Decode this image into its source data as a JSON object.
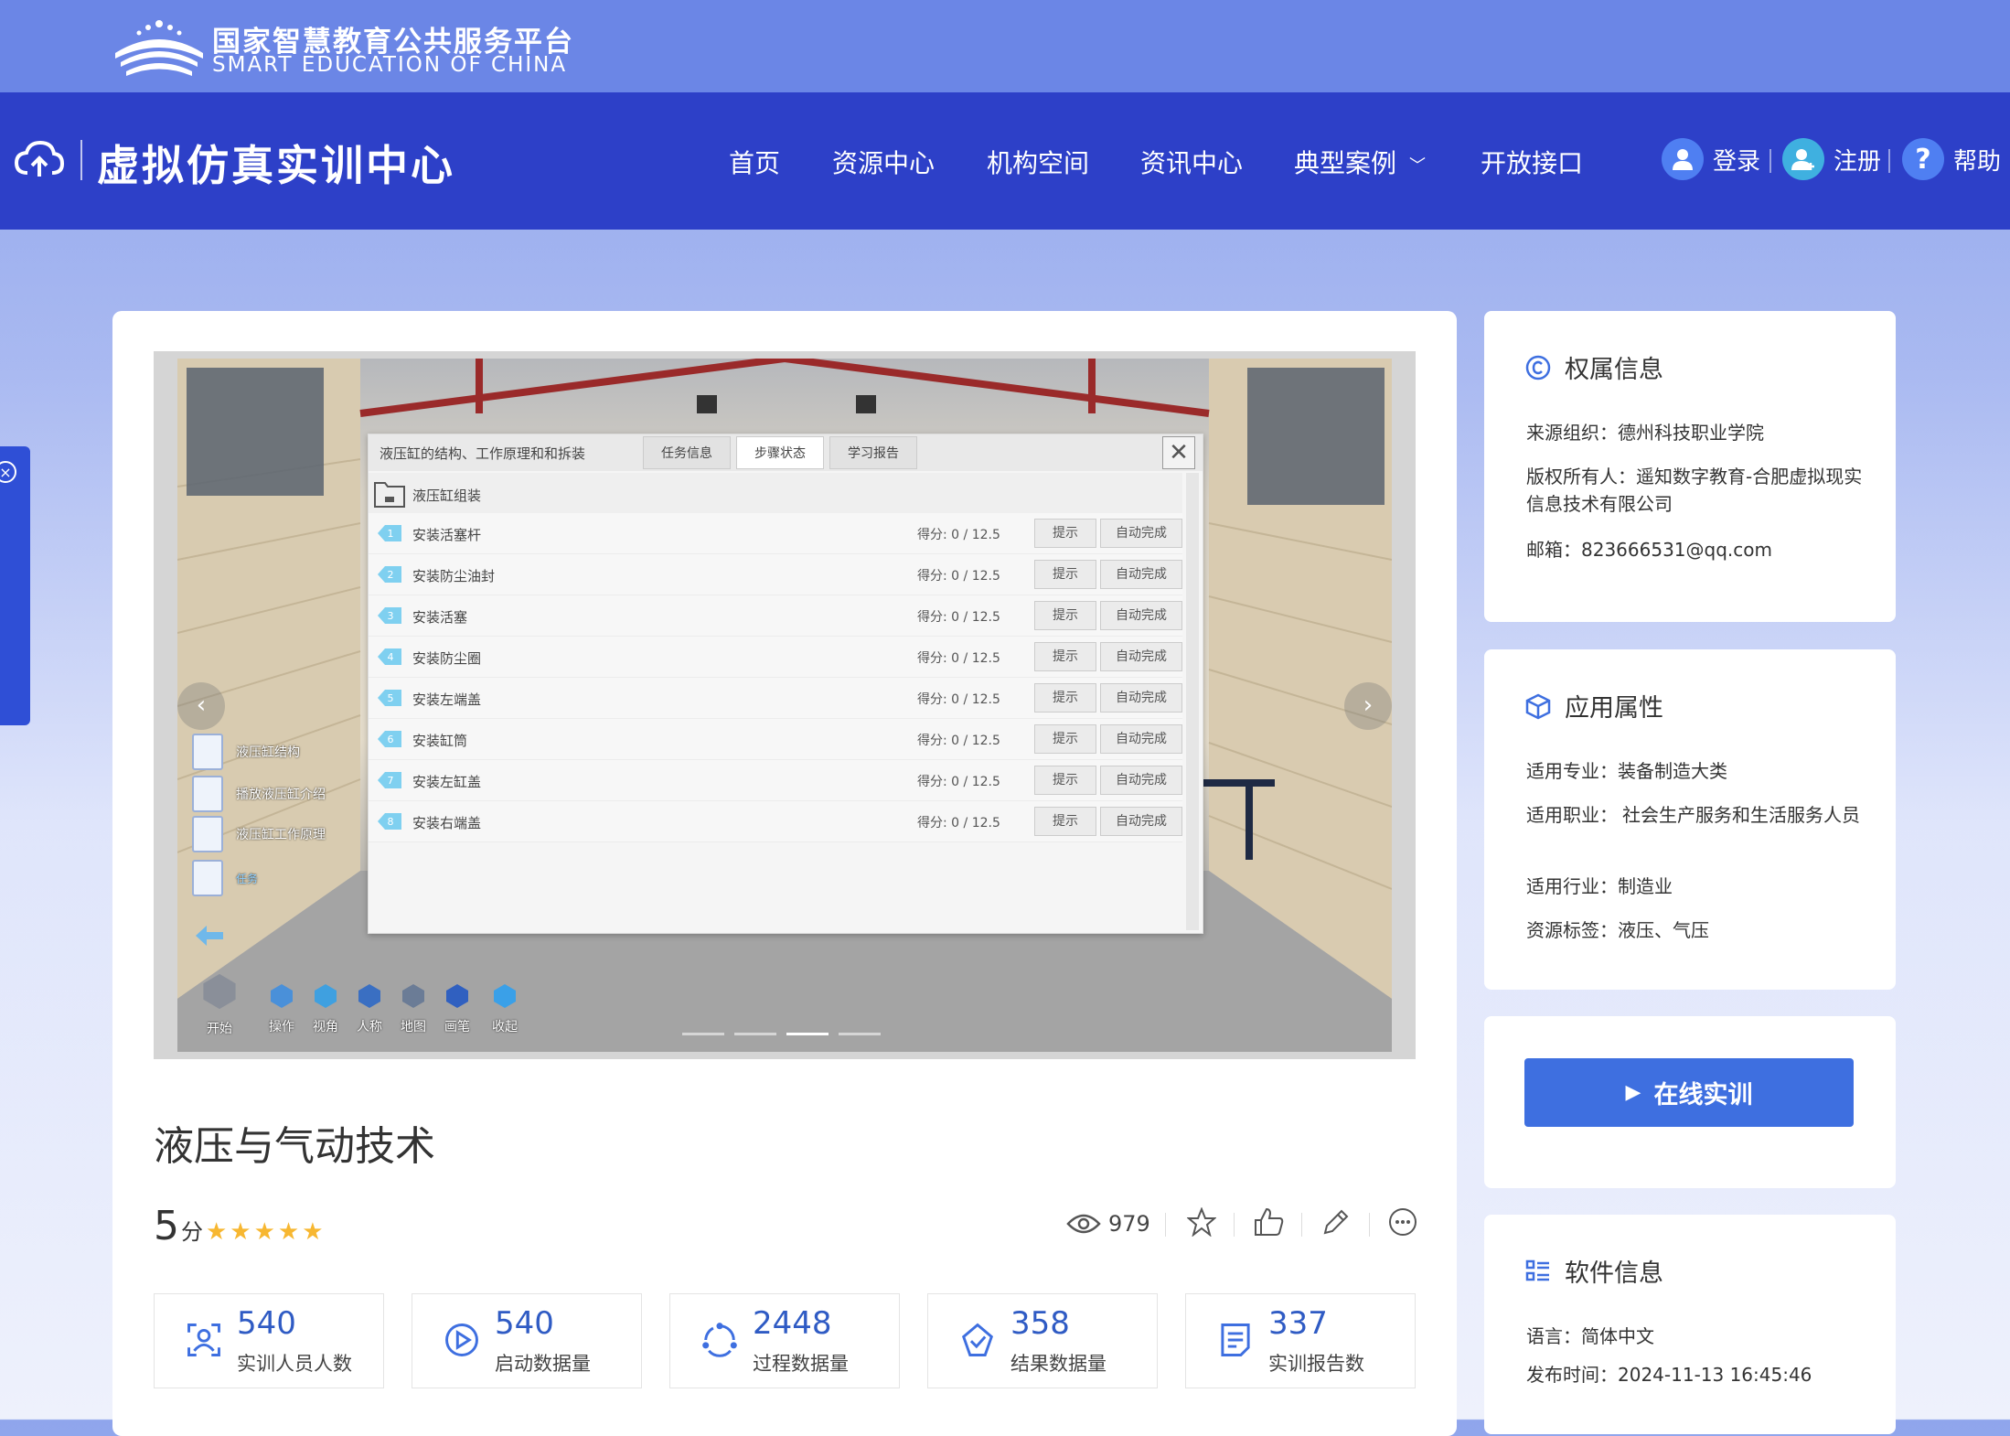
{
  "brand": {
    "cn": "国家智慧教育公共服务平台",
    "en": "SMART EDUCATION OF CHINA"
  },
  "site": {
    "title": "虚拟仿真实训中心"
  },
  "nav": {
    "items": [
      "首页",
      "资源中心",
      "机构空间",
      "资讯中心",
      "典型案例",
      "开放接口"
    ]
  },
  "user": {
    "login": "登录",
    "register": "注册",
    "help": "帮助"
  },
  "viewer": {
    "panel_title": "液压缸的结构、工作原理和和拆装",
    "tabs": [
      "任务信息",
      "步骤状态",
      "学习报告"
    ],
    "active_tab": "步骤状态",
    "group_label": "液压缸组装",
    "steps": [
      {
        "num": "1",
        "label": "安装活塞杆",
        "score": "得分:  0 / 12.5",
        "hint": "提示",
        "auto": "自动完成"
      },
      {
        "num": "2",
        "label": "安装防尘油封",
        "score": "得分:  0 / 12.5",
        "hint": "提示",
        "auto": "自动完成"
      },
      {
        "num": "3",
        "label": "安装活塞",
        "score": "得分:  0 / 12.5",
        "hint": "提示",
        "auto": "自动完成"
      },
      {
        "num": "4",
        "label": "安装防尘圈",
        "score": "得分:  0 / 12.5",
        "hint": "提示",
        "auto": "自动完成"
      },
      {
        "num": "5",
        "label": "安装左端盖",
        "score": "得分:  0 / 12.5",
        "hint": "提示",
        "auto": "自动完成"
      },
      {
        "num": "6",
        "label": "安装缸筒",
        "score": "得分:  0 / 12.5",
        "hint": "提示",
        "auto": "自动完成"
      },
      {
        "num": "7",
        "label": "安装左缸盖",
        "score": "得分:  0 / 12.5",
        "hint": "提示",
        "auto": "自动完成"
      },
      {
        "num": "8",
        "label": "安装右端盖",
        "score": "得分:  0 / 12.5",
        "hint": "提示",
        "auto": "自动完成"
      }
    ],
    "side_menu": [
      "液压缸结构",
      "播放液压缸介绍",
      "液压缸工作原理"
    ],
    "task_label": "任务",
    "tools": [
      "开始",
      "操作",
      "视角",
      "人称",
      "地图",
      "画笔",
      "收起"
    ],
    "slide_count": 4,
    "active_slide": 3
  },
  "course": {
    "title": "液压与气动技术",
    "rating_value": "5",
    "rating_unit": "分",
    "stars": "★★★★★",
    "views": "979"
  },
  "stats": [
    {
      "value": "540",
      "label": "实训人员人数",
      "icon": "user-scan-icon"
    },
    {
      "value": "540",
      "label": "启动数据量",
      "icon": "play-circle-icon"
    },
    {
      "value": "2448",
      "label": "过程数据量",
      "icon": "cycle-icon"
    },
    {
      "value": "358",
      "label": "结果数据量",
      "icon": "check-shield-icon"
    },
    {
      "value": "337",
      "label": "实训报告数",
      "icon": "report-icon"
    }
  ],
  "ownership": {
    "title": "权属信息",
    "source": "来源组织：德州科技职业学院",
    "owner": "版权所有人：遥知数字教育-合肥虚拟现实信息技术有限公司",
    "email": "邮箱：823666531@qq.com"
  },
  "attributes": {
    "title": "应用属性",
    "major": "适用专业：装备制造大类",
    "career_label": "适用职业：",
    "career_value": "社会生产服务和生活服务人员",
    "industry": "适用行业：制造业",
    "tags": "资源标签：液压、气压"
  },
  "action": {
    "online_label": "在线实训"
  },
  "software": {
    "title": "软件信息",
    "language": "语言：简体中文",
    "published": "发布时间：2024-11-13 16:45:46"
  },
  "colors": {
    "brand_bar": "#6b86e6",
    "nav_bar": "#2d40c8",
    "accent": "#3e6fe0",
    "stat_number": "#2f5bc4",
    "star": "#f7b731"
  }
}
